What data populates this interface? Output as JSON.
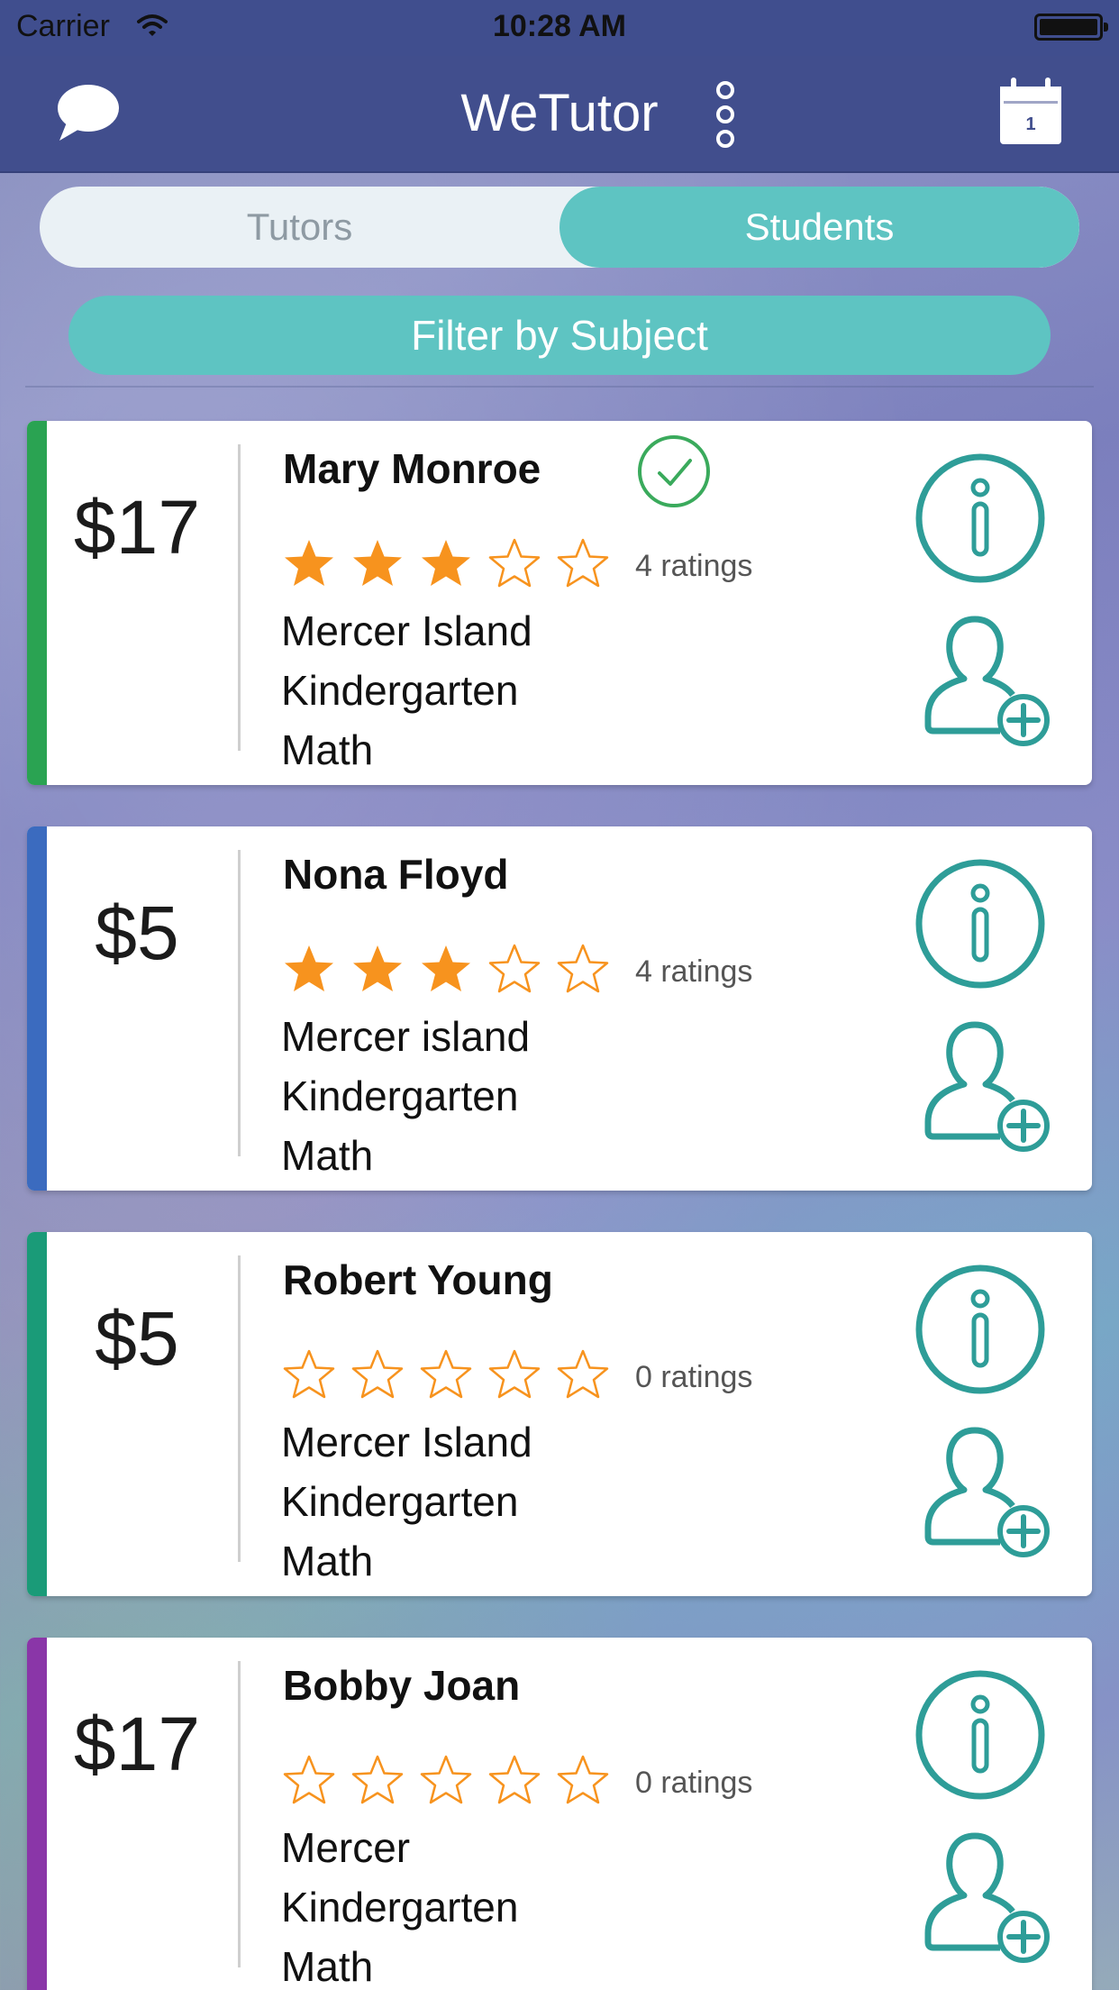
{
  "status_bar": {
    "carrier": "Carrier",
    "time": "10:28 AM"
  },
  "nav": {
    "title": "WeTutor",
    "calendar_day": "1",
    "icons": [
      "chat-bubble-icon",
      "more-vertical-icon",
      "calendar-icon"
    ]
  },
  "segmented": {
    "options": [
      "Tutors",
      "Students"
    ],
    "selected": "Students"
  },
  "filter": {
    "label": "Filter by Subject"
  },
  "colors": {
    "nav_bg": "#414e8d",
    "accent_teal": "#5ec4c2",
    "icon_teal": "#2e9d98",
    "star_orange": "#f7931e",
    "check_green": "#3aaa5c"
  },
  "students": [
    {
      "price": "$17",
      "name": "Mary Monroe",
      "verified": true,
      "rating": 3,
      "max_rating": 5,
      "ratings_text": "4 ratings",
      "location": "Mercer Island",
      "grade": "Kindergarten",
      "subject": "Math",
      "stripe_color": "#2aa352"
    },
    {
      "price": "$5",
      "name": "Nona Floyd",
      "verified": false,
      "rating": 3,
      "max_rating": 5,
      "ratings_text": "4 ratings",
      "location": "Mercer island",
      "grade": "Kindergarten",
      "subject": "Math",
      "stripe_color": "#3b6bbf"
    },
    {
      "price": "$5",
      "name": "Robert Young",
      "verified": false,
      "rating": 0,
      "max_rating": 5,
      "ratings_text": "0 ratings",
      "location": "Mercer Island",
      "grade": "Kindergarten",
      "subject": "Math",
      "stripe_color": "#1a9b78"
    },
    {
      "price": "$17",
      "name": "Bobby Joan",
      "verified": false,
      "rating": 0,
      "max_rating": 5,
      "ratings_text": "0 ratings",
      "location": "Mercer",
      "grade": "Kindergarten",
      "subject": "Math",
      "stripe_color": "#8a36a8"
    }
  ]
}
